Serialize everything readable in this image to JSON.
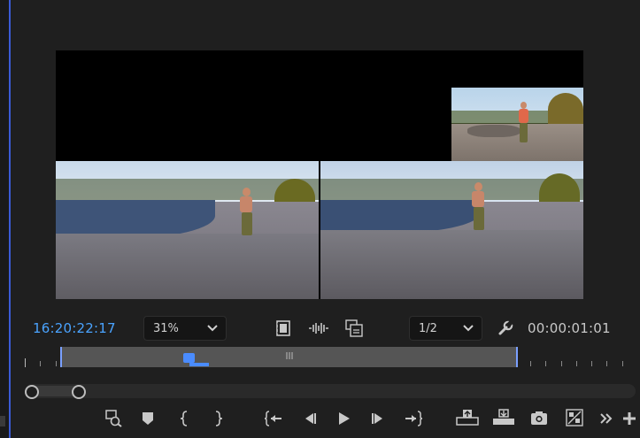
{
  "program_monitor": {
    "timecode_current": "16:20:22:17",
    "timecode_duration": "00:00:01:01",
    "zoom": {
      "selected": "31%"
    },
    "resolution": {
      "selected": "1/2"
    }
  },
  "colors": {
    "accent_blue": "#4aa3ff",
    "playhead_blue": "#4a8cff",
    "background": "#1f1f1f"
  },
  "icons": {
    "toolbar_top": [
      "film-strip-icon",
      "audio-waveform-icon",
      "multicam-icon",
      "wrench-icon"
    ],
    "transport": [
      "zoom-search-icon",
      "add-marker-icon",
      "mark-in-icon",
      "mark-out-icon",
      "go-to-in-icon",
      "step-back-icon",
      "play-icon",
      "step-forward-icon",
      "go-to-out-icon",
      "lift-icon",
      "extract-icon",
      "export-frame-icon",
      "compare-view-icon",
      "more-controls-icon",
      "add-button-icon"
    ]
  }
}
